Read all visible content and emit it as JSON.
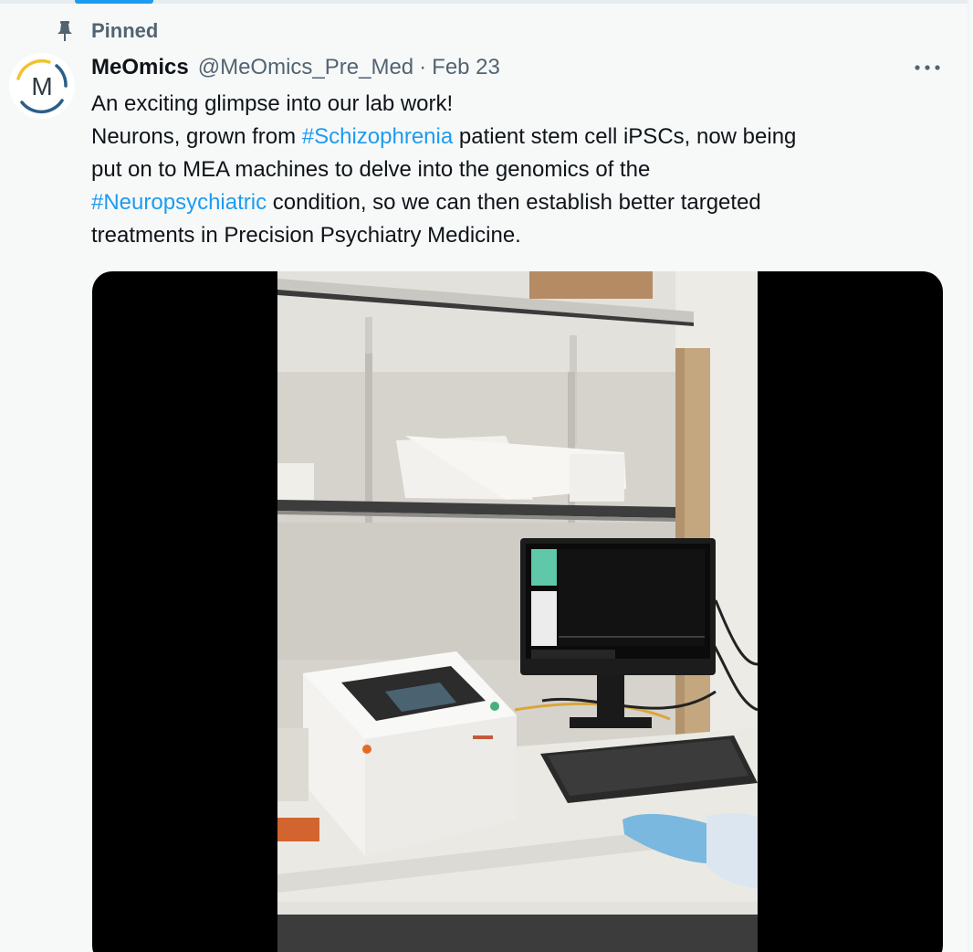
{
  "pinned": {
    "label": "Pinned",
    "icon": "pin-icon"
  },
  "author": {
    "avatar_letter": "M",
    "display_name": "MeOmics",
    "handle": "@MeOmics_Pre_Med",
    "separator": "·",
    "date": "Feb 23"
  },
  "more": {
    "icon": "more-horizontal-icon"
  },
  "tweet": {
    "line1": "An exciting glimpse into our lab work!",
    "line2_a": "Neurons, grown from ",
    "line2_tag": "#Schizophrenia",
    "line2_b": " patient stem cell iPSCs, now being",
    "line3": "put on to MEA machines to delve into the genomics of the",
    "line4_tag": "#Neuropsychiatric",
    "line4_b": " condition, so we can then establish better targeted",
    "line5": "treatments in Precision Psychiatry Medicine."
  },
  "colors": {
    "accent": "#1d9bf0",
    "text": "#0f1419",
    "secondary": "#536471",
    "background": "#f7f9f9",
    "avatar_yellow": "#f2c12e",
    "avatar_blue": "#2b5f8a"
  },
  "media": {
    "type": "video",
    "icon": "video-thumbnail"
  }
}
